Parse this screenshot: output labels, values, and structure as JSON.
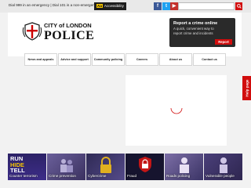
{
  "topbar": {
    "emergency_text": "Dial 999 in an emergency | Dial 101 is a non-emergency",
    "accessibility_label": "Accessibility",
    "accessibility_icon": "Aa",
    "social": {
      "facebook": "f",
      "twitter": "t",
      "youtube": "▶"
    },
    "search_placeholder": ""
  },
  "logo": {
    "city_text": "CITY of LONDON",
    "police_text": "POLICE"
  },
  "report": {
    "title": "Report a crime online",
    "description": "A quick, convenient way to report crime and incidents",
    "button_label": "Report"
  },
  "nav": {
    "items": [
      "News and appeals",
      "Advice and support",
      "Community policing",
      "Careers",
      "About us",
      "Contact us"
    ]
  },
  "help_tab": {
    "label": "Help page"
  },
  "tiles": [
    {
      "caption": "Counter terrorism",
      "badge_line1": "RUN",
      "badge_line2": "HIDE",
      "badge_line3": "TELL"
    },
    {
      "caption": "Crime prevention"
    },
    {
      "caption": "Cybercrime"
    },
    {
      "caption": "Fraud"
    },
    {
      "caption": "Roads policing"
    },
    {
      "caption": "Vulnerable people"
    }
  ],
  "colors": {
    "brand_red": "#d10d0d",
    "dark_panel": "#2a2a2a",
    "accent_yellow": "#f4c400"
  }
}
